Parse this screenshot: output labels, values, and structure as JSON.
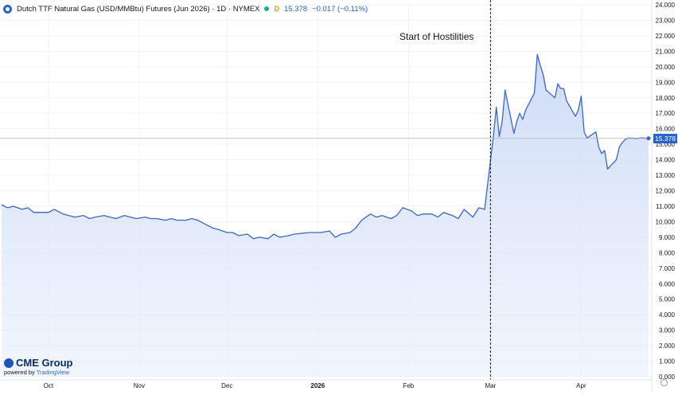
{
  "header": {
    "title": "Dutch TTF Natural Gas (USD/MMBtu) Futures (Jun 2026) · 1D · NYMEX",
    "delay_badge": "D",
    "last_price": "15.378",
    "change": "−0.017 (−0.11%)"
  },
  "annotation": "Start of Hostilities",
  "branding": {
    "logo": "CME Group",
    "powered_by": "powered by",
    "powered_by_brand": "TradingView"
  },
  "last_price_badge": "15.378",
  "colors": {
    "line": "#3a66c4",
    "area": "#e6edfb",
    "badge": "#2a62c9",
    "accent": "#2962ff"
  },
  "chart_data": {
    "type": "area",
    "title": "Dutch TTF Natural Gas (USD/MMBtu) Futures (Jun 2026) · 1D · NYMEX",
    "xlabel": "",
    "ylabel": "",
    "ylim": [
      0,
      24
    ],
    "y_ticks": [
      "0.000",
      "1.000",
      "2.000",
      "3.000",
      "4.000",
      "5.000",
      "6.000",
      "7.000",
      "8.000",
      "9.000",
      "10.000",
      "11.000",
      "12.000",
      "13.000",
      "14.000",
      "15.000",
      "16.000",
      "17.000",
      "18.000",
      "19.000",
      "20.000",
      "21.000",
      "22.000",
      "23.000",
      "24.000"
    ],
    "x_tick_labels": [
      "Oct",
      "Nov",
      "Dec",
      "2026",
      "Feb",
      "Mar",
      "Apr"
    ],
    "x_tick_dates": [
      "2025-10-01",
      "2025-11-01",
      "2025-12-01",
      "2026-01-01",
      "2026-02-01",
      "2026-03-01",
      "2026-04-01"
    ],
    "grid": true,
    "legend": "top-left",
    "vertical_marker": {
      "date": "2026-03-01",
      "label": "Start of Hostilities"
    },
    "last_value": 15.378,
    "series": [
      {
        "x": [
          "2025-09-15",
          "2025-09-17",
          "2025-09-19",
          "2025-09-22",
          "2025-09-24",
          "2025-09-26",
          "2025-09-29",
          "2025-10-01",
          "2025-10-03",
          "2025-10-06",
          "2025-10-08",
          "2025-10-10",
          "2025-10-13",
          "2025-10-15",
          "2025-10-17",
          "2025-10-20",
          "2025-10-22",
          "2025-10-24",
          "2025-10-27",
          "2025-10-29",
          "2025-10-31",
          "2025-11-03",
          "2025-11-05",
          "2025-11-07",
          "2025-11-10",
          "2025-11-12",
          "2025-11-14",
          "2025-11-17",
          "2025-11-19",
          "2025-11-21",
          "2025-11-24",
          "2025-11-26",
          "2025-11-28",
          "2025-12-01",
          "2025-12-03",
          "2025-12-05",
          "2025-12-08",
          "2025-12-10",
          "2025-12-12",
          "2025-12-15",
          "2025-12-17",
          "2025-12-19",
          "2025-12-22",
          "2025-12-24",
          "2025-12-29",
          "2026-01-02",
          "2026-01-05",
          "2026-01-07",
          "2026-01-09",
          "2026-01-12",
          "2026-01-14",
          "2026-01-16",
          "2026-01-19",
          "2026-01-21",
          "2026-01-23",
          "2026-01-26",
          "2026-01-28",
          "2026-01-30",
          "2026-02-02",
          "2026-02-04",
          "2026-02-06",
          "2026-02-09",
          "2026-02-11",
          "2026-02-13",
          "2026-02-16",
          "2026-02-18",
          "2026-02-20",
          "2026-02-23",
          "2026-02-25",
          "2026-02-27",
          "2026-03-02",
          "2026-03-03",
          "2026-03-04",
          "2026-03-05",
          "2026-03-06",
          "2026-03-09",
          "2026-03-10",
          "2026-03-11",
          "2026-03-12",
          "2026-03-13",
          "2026-03-16",
          "2026-03-17",
          "2026-03-18",
          "2026-03-19",
          "2026-03-20",
          "2026-03-23",
          "2026-03-24",
          "2026-03-25",
          "2026-03-26",
          "2026-03-27",
          "2026-03-30",
          "2026-03-31",
          "2026-04-01",
          "2026-04-02",
          "2026-04-03",
          "2026-04-06",
          "2026-04-07",
          "2026-04-08",
          "2026-04-09",
          "2026-04-10",
          "2026-04-13",
          "2026-04-14",
          "2026-04-15",
          "2026-04-16",
          "2026-04-17",
          "2026-04-20",
          "2026-04-21",
          "2026-04-22",
          "2026-04-23",
          "2026-04-24"
        ],
        "values": [
          11.1,
          10.9,
          11.0,
          10.8,
          10.9,
          10.6,
          10.6,
          10.6,
          10.8,
          10.5,
          10.4,
          10.3,
          10.4,
          10.2,
          10.3,
          10.4,
          10.3,
          10.2,
          10.4,
          10.3,
          10.2,
          10.3,
          10.2,
          10.2,
          10.1,
          10.2,
          10.1,
          10.1,
          10.2,
          10.1,
          9.8,
          9.6,
          9.5,
          9.3,
          9.3,
          9.1,
          9.2,
          8.9,
          9.0,
          8.9,
          9.2,
          9.0,
          9.1,
          9.2,
          9.3,
          9.3,
          9.4,
          9.0,
          9.2,
          9.3,
          9.6,
          10.1,
          10.5,
          10.3,
          10.4,
          10.2,
          10.4,
          10.9,
          10.7,
          10.4,
          10.5,
          10.5,
          10.3,
          10.6,
          10.4,
          10.2,
          10.8,
          10.3,
          10.9,
          10.8,
          15.5,
          17.4,
          15.5,
          16.5,
          18.5,
          15.7,
          16.5,
          17.0,
          16.6,
          17.2,
          18.3,
          20.8,
          20.1,
          19.5,
          18.5,
          18.0,
          18.9,
          18.6,
          18.6,
          17.8,
          16.8,
          17.2,
          18.1,
          15.8,
          15.4,
          15.8,
          14.8,
          14.4,
          14.6,
          13.4,
          14.0,
          14.8,
          15.1,
          15.3,
          15.4,
          15.378,
          15.4,
          15.4,
          15.38,
          15.378
        ]
      }
    ]
  }
}
